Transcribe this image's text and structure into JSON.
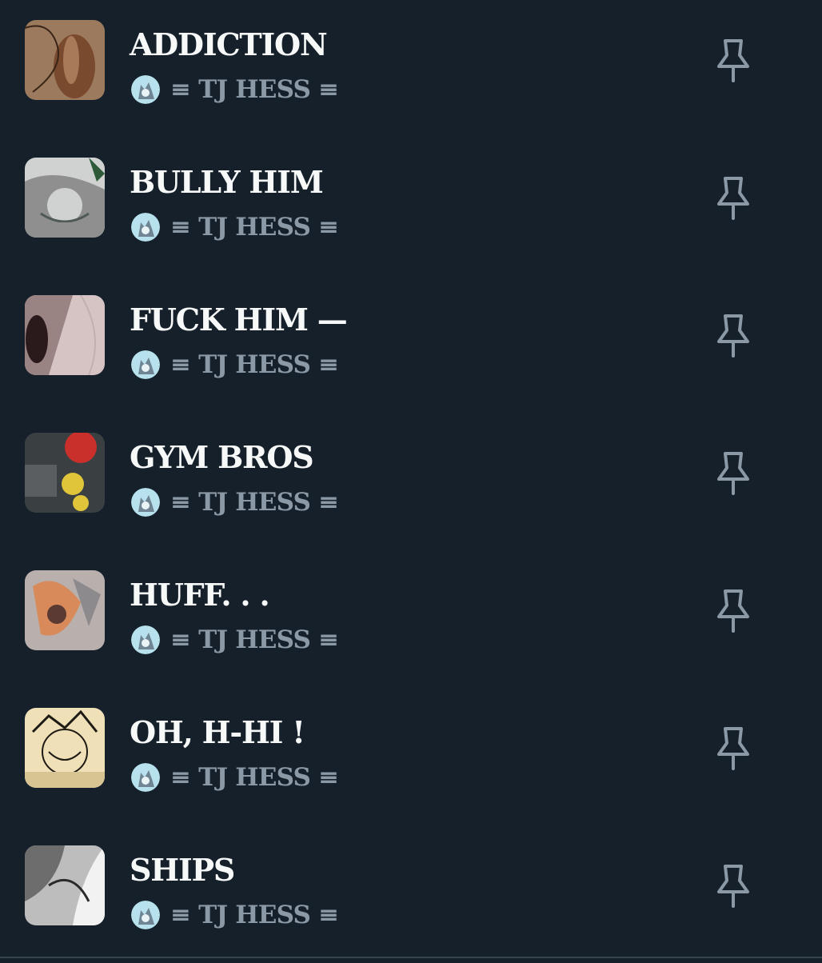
{
  "lists": [
    {
      "title": "ADDICTION",
      "owner": "≡ TJ HESS ≡",
      "thumb_colors": [
        "#9c7a5d",
        "#7a4a2e",
        "#c69b78",
        "#3a2418"
      ]
    },
    {
      "title": "BULLY HIM",
      "owner": "≡ TJ HESS ≡",
      "thumb_colors": [
        "#cfd2d0",
        "#8e8f8e",
        "#4f5a55",
        "#2e5a3a"
      ]
    },
    {
      "title": "FUCK HIM —",
      "owner": "≡ TJ HESS ≡",
      "thumb_colors": [
        "#d6c4c4",
        "#9a8383",
        "#2a1a1c",
        "#c2b0b0"
      ]
    },
    {
      "title": "GYM BROS",
      "owner": "≡ TJ HESS ≡",
      "thumb_colors": [
        "#c9302b",
        "#3a3f42",
        "#e0c53a",
        "#5a5e60"
      ]
    },
    {
      "title": "HUFF. . .",
      "owner": "≡ TJ HESS ≡",
      "thumb_colors": [
        "#b9b0ad",
        "#d98a5a",
        "#5a3a32",
        "#8c8a8c"
      ]
    },
    {
      "title": "OH, H-HI !",
      "owner": "≡ TJ HESS ≡",
      "thumb_colors": [
        "#efe0b8",
        "#1e1a14",
        "#d7c492",
        "#8a7c5c"
      ]
    },
    {
      "title": "SHIPS",
      "owner": "≡ TJ HESS ≡",
      "thumb_colors": [
        "#bdbdbd",
        "#6d6d6d",
        "#f2f2f2",
        "#2a2a2a"
      ]
    }
  ],
  "icons": {
    "pin": "pin-icon",
    "owner_avatar": "owner-avatar"
  },
  "colors": {
    "background": "#15202b",
    "title_text": "#f7f9f9",
    "secondary_text": "#8b98a5",
    "avatar_bg": "#b8e1ee"
  }
}
